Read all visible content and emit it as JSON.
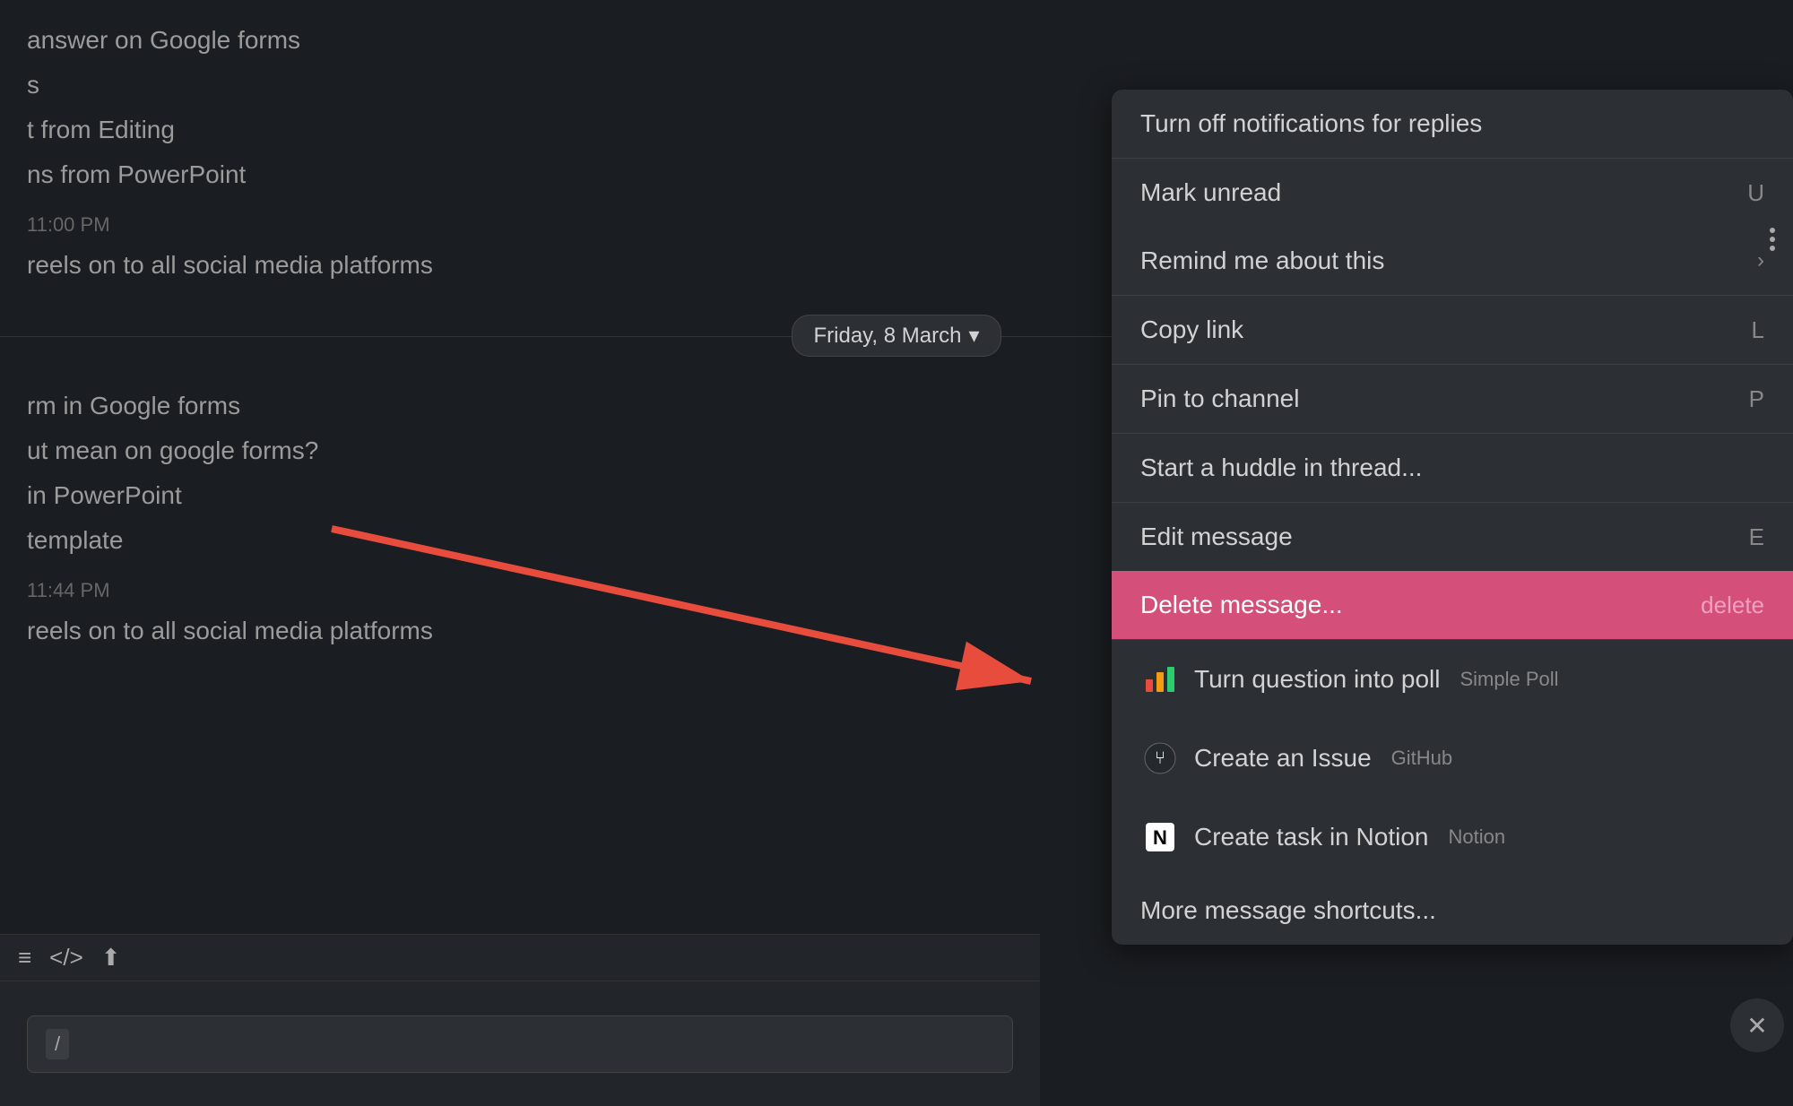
{
  "chat": {
    "lines": [
      {
        "text": "answer on Google forms",
        "type": "normal"
      },
      {
        "text": "s",
        "type": "normal"
      },
      {
        "text": "t from Editing",
        "type": "normal"
      },
      {
        "text": "ns from PowerPoint",
        "type": "normal"
      },
      {
        "text": "11:00 PM",
        "type": "timestamp"
      },
      {
        "text": "reels on to all social media platforms",
        "type": "normal"
      }
    ],
    "dateDivider": "Friday, 8 March",
    "dateDividerChevron": "▾",
    "lines2": [
      {
        "text": "rm in Google forms",
        "type": "normal"
      },
      {
        "text": "ut mean on google forms?",
        "type": "normal"
      },
      {
        "text": "in PowerPoint",
        "type": "normal"
      },
      {
        "text": "template",
        "type": "normal"
      },
      {
        "text": "11:44 PM",
        "type": "timestamp"
      },
      {
        "text": "reels on to all social media platforms",
        "type": "normal"
      }
    ]
  },
  "toolbar": {
    "icons": [
      "≡",
      "</>",
      "⬆"
    ]
  },
  "inputArea": {
    "slashLabel": "/",
    "placeholder": ""
  },
  "contextMenu": {
    "sections": [
      {
        "items": [
          {
            "label": "Turn off notifications for replies",
            "shortcut": "",
            "chevron": "",
            "highlighted": false,
            "hasIcon": false
          }
        ]
      },
      {
        "items": [
          {
            "label": "Mark unread",
            "shortcut": "U",
            "chevron": "",
            "highlighted": false,
            "hasIcon": false
          },
          {
            "label": "Remind me about this",
            "shortcut": "",
            "chevron": "›",
            "highlighted": false,
            "hasIcon": false
          }
        ]
      },
      {
        "items": [
          {
            "label": "Copy link",
            "shortcut": "L",
            "chevron": "",
            "highlighted": false,
            "hasIcon": false
          }
        ]
      },
      {
        "items": [
          {
            "label": "Pin to channel",
            "shortcut": "P",
            "chevron": "",
            "highlighted": false,
            "hasIcon": false
          }
        ]
      },
      {
        "items": [
          {
            "label": "Start a huddle in thread...",
            "shortcut": "",
            "chevron": "",
            "highlighted": false,
            "hasIcon": false
          }
        ]
      },
      {
        "items": [
          {
            "label": "Edit message",
            "shortcut": "E",
            "chevron": "",
            "highlighted": false,
            "hasIcon": false
          },
          {
            "label": "Delete message...",
            "shortcut": "delete",
            "chevron": "",
            "highlighted": true,
            "hasIcon": false
          }
        ]
      },
      {
        "items": [
          {
            "label": "Turn question into poll",
            "sublabel": "Simple Poll",
            "shortcut": "",
            "chevron": "",
            "highlighted": false,
            "hasIcon": true,
            "iconType": "poll"
          },
          {
            "label": "Create an Issue",
            "sublabel": "GitHub",
            "shortcut": "",
            "chevron": "",
            "highlighted": false,
            "hasIcon": true,
            "iconType": "github"
          },
          {
            "label": "Create task in Notion",
            "sublabel": "Notion",
            "shortcut": "",
            "chevron": "",
            "highlighted": false,
            "hasIcon": true,
            "iconType": "notion"
          },
          {
            "label": "More message shortcuts...",
            "shortcut": "",
            "chevron": "",
            "highlighted": false,
            "hasIcon": false
          }
        ]
      }
    ]
  }
}
